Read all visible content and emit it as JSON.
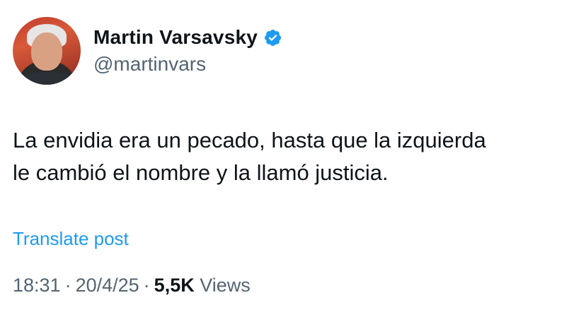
{
  "author": {
    "display_name": "Martin Varsavsky",
    "handle": "@martinvars",
    "verified": true
  },
  "post": {
    "lines": [
      "La envidia era un pecado, hasta que la izquierda",
      "le cambió el nombre y la llamó justicia."
    ],
    "translate_label": "Translate post"
  },
  "meta": {
    "time": "18:31",
    "separator": "·",
    "date": "20/4/25",
    "views_count": "5,5K",
    "views_label": "Views"
  },
  "colors": {
    "text": "#0f1419",
    "secondary": "#536471",
    "link": "#1d9bf0",
    "verified_badge": "#1d9bf0"
  },
  "icons": {
    "verified": "verified-badge-icon",
    "avatar": "profile-photo"
  }
}
